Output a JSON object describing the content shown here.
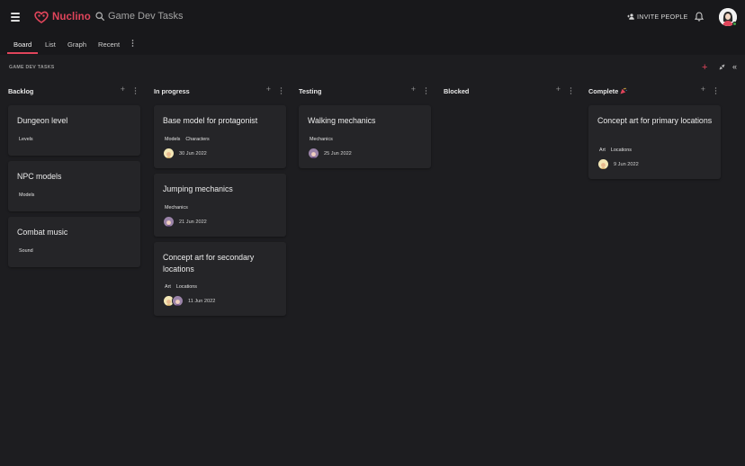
{
  "app": {
    "name": "Nuclino",
    "brand_color": "#e0455b",
    "search_text": "Game Dev Tasks",
    "invite_label": "INVITE PEOPLE"
  },
  "icons": [
    "menu-icon",
    "nuclino-logo-icon",
    "search-icon",
    "add-user-icon",
    "bell-icon",
    "user-avatar",
    "more-vertical-icon",
    "plus-icon",
    "collapse-icon",
    "chevrons-left-icon",
    "party-popper-icon"
  ],
  "tabs": [
    {
      "label": "Board",
      "active": true
    },
    {
      "label": "List",
      "active": false
    },
    {
      "label": "Graph",
      "active": false
    },
    {
      "label": "Recent",
      "active": false
    }
  ],
  "board": {
    "breadcrumb": "GAME DEV TASKS",
    "columns": [
      {
        "title": "Backlog",
        "cards": [
          {
            "title": "Dungeon level",
            "tags": [
              "Levels"
            ]
          },
          {
            "title": "NPC models",
            "tags": [
              "Models"
            ]
          },
          {
            "title": "Combat music",
            "tags": [
              "Sound"
            ]
          }
        ]
      },
      {
        "title": "In progress",
        "cards": [
          {
            "title": "Base model for protagonist",
            "tags": [
              "Models",
              "Characters"
            ],
            "date": "30 Jun 2022",
            "assignees": [
              "yellow"
            ]
          },
          {
            "title": "Jumping mechanics",
            "tags": [
              "Mechanics"
            ],
            "date": "21 Jun 2022",
            "assignees": [
              "purple"
            ]
          },
          {
            "title": "Concept art for secondary locations",
            "tags": [
              "Art",
              "Locations"
            ],
            "date": "11 Jun 2022",
            "assignees": [
              "yellow",
              "purple"
            ]
          }
        ]
      },
      {
        "title": "Testing",
        "cards": [
          {
            "title": "Walking mechanics",
            "tags": [
              "Mechanics"
            ],
            "date": "25 Jun 2022",
            "assignees": [
              "purple"
            ]
          }
        ]
      },
      {
        "title": "Blocked",
        "cards": []
      },
      {
        "title": "Complete",
        "cards": [
          {
            "title": "Concept art for primary locations",
            "tags": [
              "Art",
              "Locations"
            ],
            "date": "9 Jun 2022",
            "assignees": [
              "yellow"
            ]
          }
        ]
      }
    ]
  }
}
